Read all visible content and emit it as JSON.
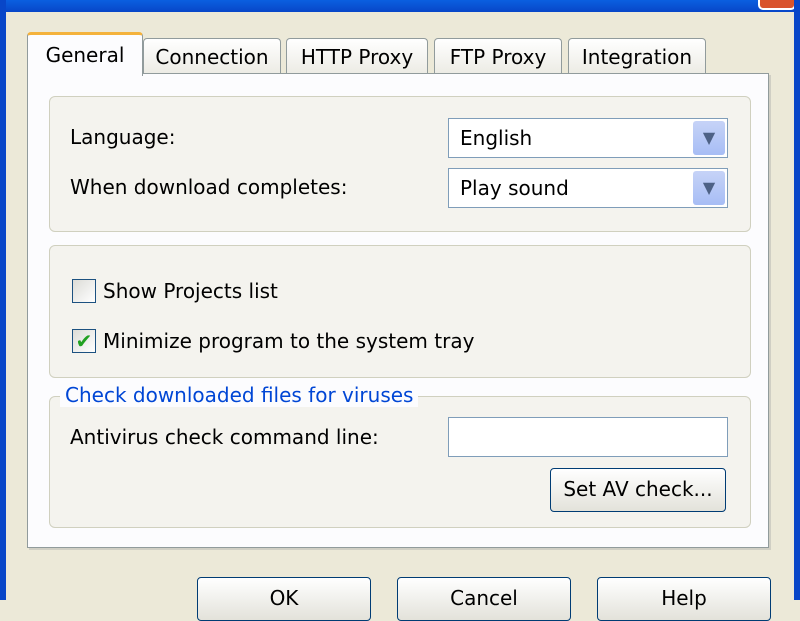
{
  "tabs": [
    "General",
    "Connection",
    "HTTP Proxy",
    "FTP Proxy",
    "Integration"
  ],
  "general": {
    "language_label": "Language:",
    "language_value": "English",
    "download_label": "When download completes:",
    "download_value": "Play sound",
    "show_projects": {
      "label": "Show Projects list",
      "checked": false
    },
    "minimize_tray": {
      "label": "Minimize program to the system tray",
      "checked": true,
      "mark": "✔"
    },
    "virus_group": "Check downloaded files for viruses",
    "av_label": "Antivirus check command line:",
    "av_value": "",
    "set_av_button": "Set AV check..."
  },
  "buttons": {
    "ok": "OK",
    "cancel": "Cancel",
    "help": "Help"
  },
  "icons": {
    "dropdown": "chevron-down-icon",
    "close": "close-icon"
  }
}
